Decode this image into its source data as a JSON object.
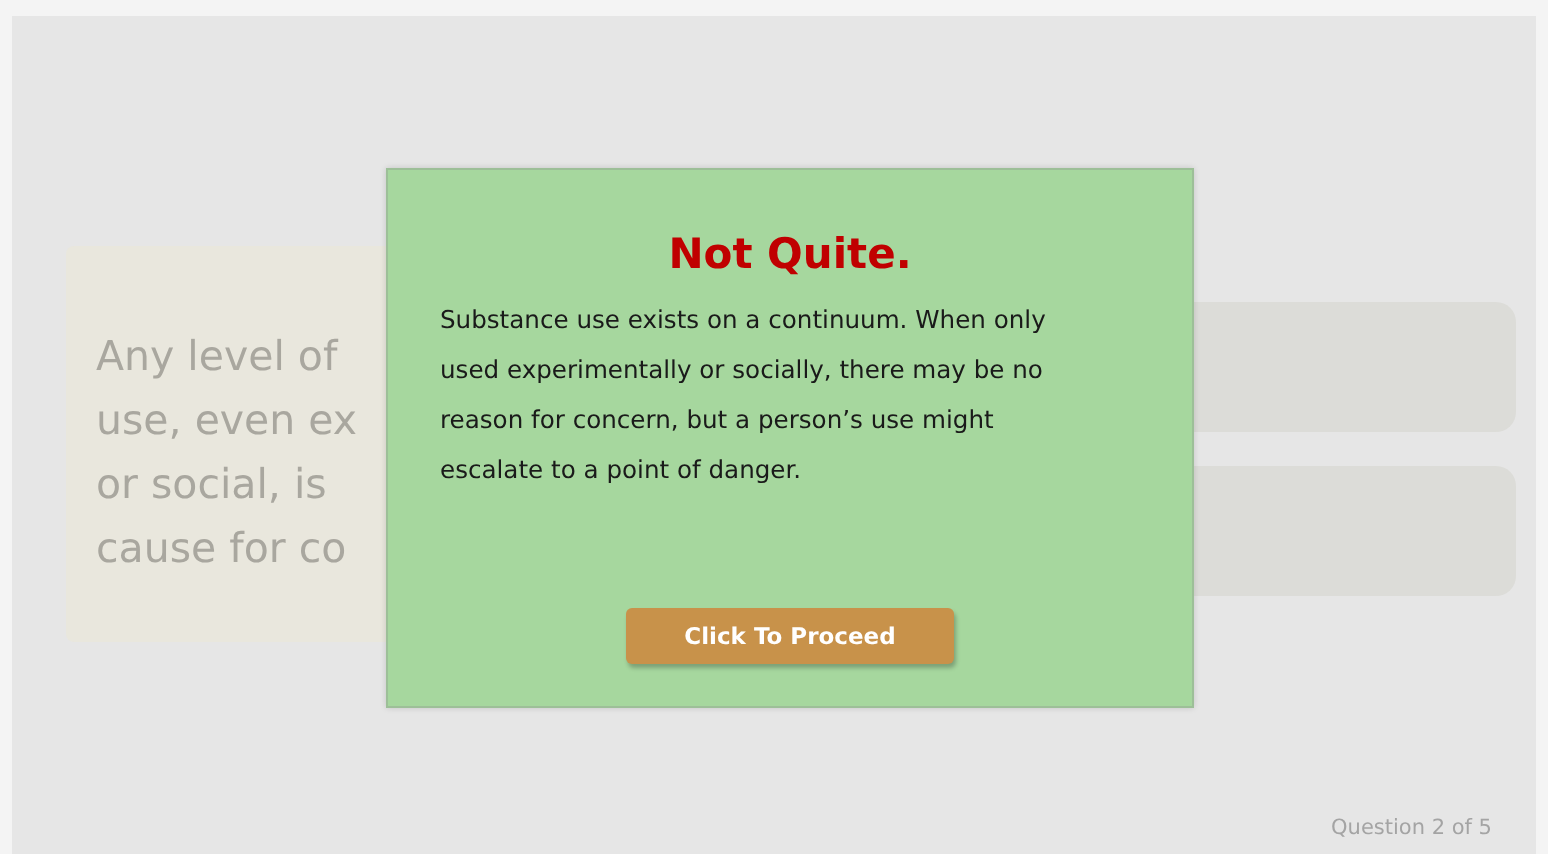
{
  "question": {
    "lines": [
      "Any level of",
      "use, even ex",
      "or social, is",
      "cause for co"
    ]
  },
  "options": [
    {
      "kind": "option"
    },
    {
      "kind": "option"
    }
  ],
  "feedback": {
    "title": "Not Quite.",
    "message": "Substance use exists on a continuum. When only used experimentally or socially, there may be no reason for concern, but a person’s use might escalate to a point of danger.",
    "button": "Click To Proceed"
  },
  "footer": {
    "progress": "Question 2 of 5"
  }
}
